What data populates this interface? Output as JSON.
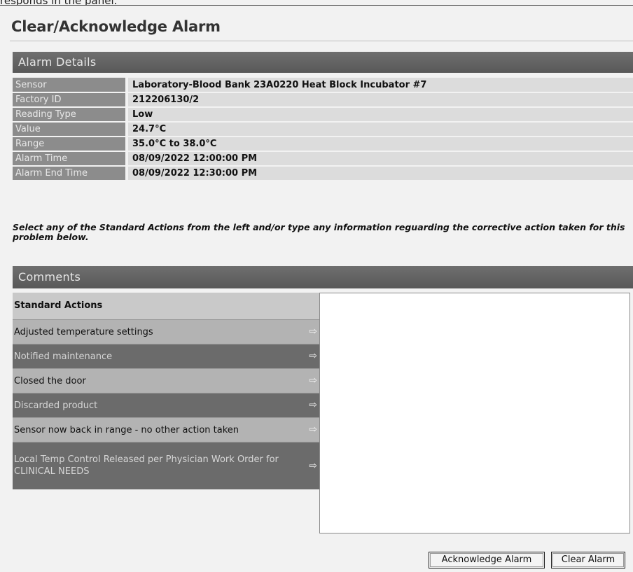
{
  "top_caption": "responds in the panel.",
  "page_title": "Clear/Acknowledge Alarm",
  "alarm_details": {
    "header": "Alarm Details",
    "rows": [
      {
        "label": "Sensor",
        "value": "Laboratory-Blood Bank 23A0220 Heat Block Incubator #7"
      },
      {
        "label": "Factory ID",
        "value": "212206130/2"
      },
      {
        "label": "Reading Type",
        "value": "Low"
      },
      {
        "label": "Value",
        "value": "24.7°C"
      },
      {
        "label": "Range",
        "value": "35.0°C to 38.0°C"
      },
      {
        "label": "Alarm Time",
        "value": "08/09/2022 12:00:00 PM"
      },
      {
        "label": "Alarm End Time",
        "value": "08/09/2022 12:30:00 PM"
      }
    ]
  },
  "instructions": "Select any of the Standard Actions from the left and/or type any information reguarding the corrective action taken for this problem below.",
  "comments": {
    "header": "Comments",
    "standard_actions_label": "Standard Actions",
    "actions": [
      {
        "label": "Adjusted temperature settings",
        "arrow": "⇨"
      },
      {
        "label": "Notified maintenance",
        "arrow": "⇨"
      },
      {
        "label": "Closed the door",
        "arrow": "⇨"
      },
      {
        "label": "Discarded product",
        "arrow": "⇨"
      },
      {
        "label": "Sensor now back in range - no other action taken",
        "arrow": "⇨"
      },
      {
        "label": "Local Temp Control Released per Physician Work Order for CLINICAL NEEDS",
        "arrow": "⇨"
      }
    ],
    "textarea_value": ""
  },
  "buttons": {
    "acknowledge": "Acknowledge Alarm",
    "clear": "Clear Alarm"
  },
  "icons": {
    "action_arrow": "arrow-right-icon"
  }
}
